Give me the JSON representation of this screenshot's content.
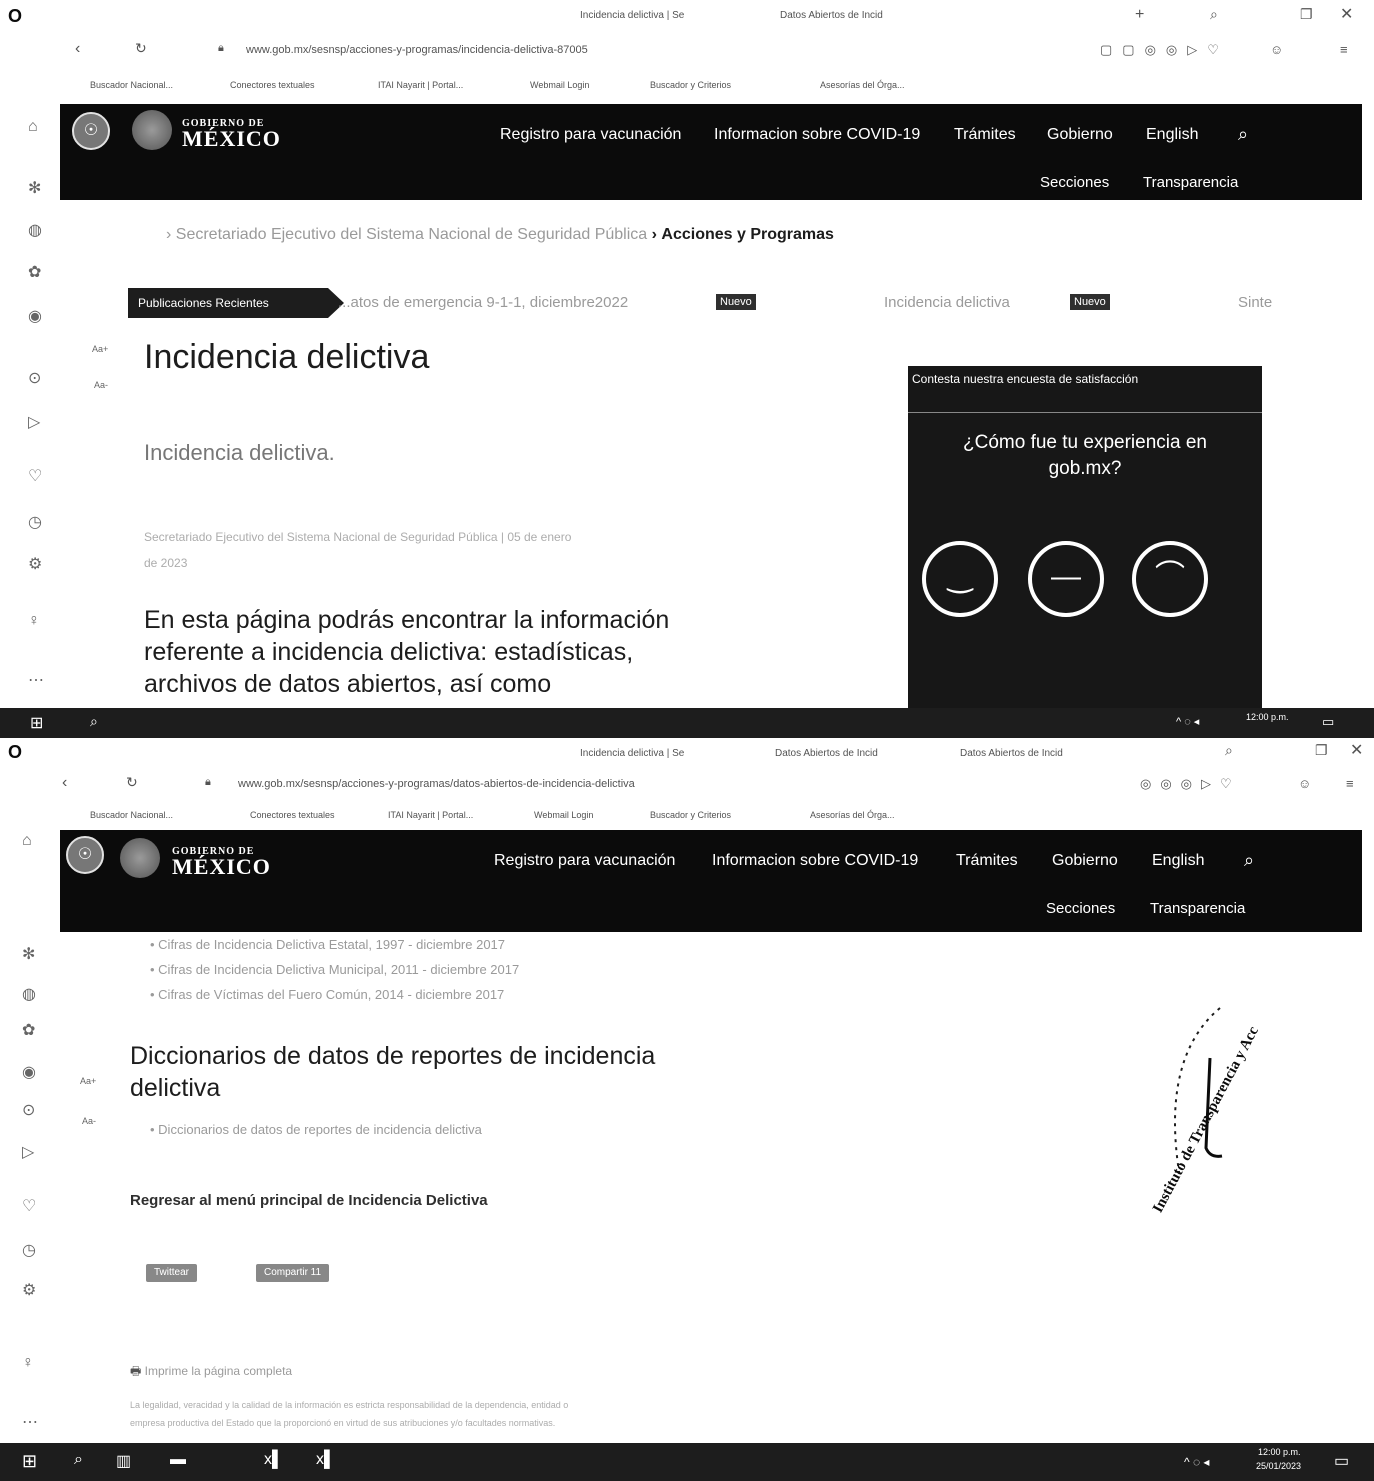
{
  "top": {
    "tabs": [
      "Incidencia delictiva | Se",
      "Datos Abiertos de Incid"
    ],
    "url": "www.gob.mx/sesnsp/acciones-y-programas/incidencia-delictiva-87005",
    "bookmarks": [
      "Buscador Nacional...",
      "Conectores textuales",
      "ITAI Nayarit | Portal...",
      "Webmail Login",
      "Buscador y Criterios",
      "Asesorías del Órga..."
    ],
    "nav": {
      "brand_small": "GOBIERNO DE",
      "brand_large": "MÉXICO",
      "links": [
        "Registro para vacunación",
        "Informacion sobre COVID-19",
        "Trámites",
        "Gobierno",
        "English"
      ],
      "sub_links": [
        "Secciones",
        "Transparencia"
      ]
    },
    "breadcrumb_prefix": "›",
    "breadcrumb_parent": "Secretariado Ejecutivo del Sistema Nacional de Seguridad Pública",
    "breadcrumb_sep": "›",
    "breadcrumb_current": "Acciones y Programas",
    "ticker": {
      "label": "Publicaciones Recientes",
      "item1": "...atos de emergencia 9-1-1, diciembre2022",
      "new_badge": "Nuevo",
      "item2": "Incidencia delictiva",
      "item3": "Sinte"
    },
    "font_tool_1": "Aa+",
    "font_tool_2": "Aa-",
    "page_title": "Incidencia delictiva",
    "subtitle": "Incidencia delictiva.",
    "meta_line1": "Secretariado Ejecutivo del Sistema Nacional de Seguridad Pública | 05 de enero",
    "meta_line2": "de 2023",
    "intro_l1": "En esta página podrás encontrar la información",
    "intro_l2": "referente a incidencia delictiva: estadísticas,",
    "intro_l3": "archivos de datos abiertos, así como",
    "survey": {
      "title": "Contesta nuestra encuesta de satisfacción",
      "question_l1": "¿Cómo fue tu experiencia en",
      "question_l2": "gob.mx?"
    },
    "clock": "12:00 p.m."
  },
  "bottom": {
    "tabs": [
      "Incidencia delictiva | Se",
      "Datos Abiertos de Incid",
      "Datos Abiertos de Incid"
    ],
    "url": "www.gob.mx/sesnsp/acciones-y-programas/datos-abiertos-de-incidencia-delictiva",
    "bookmarks": [
      "Buscador Nacional...",
      "Conectores textuales",
      "ITAI Nayarit | Portal...",
      "Webmail Login",
      "Buscador y Criterios",
      "Asesorías del Órga..."
    ],
    "nav": {
      "brand_small": "GOBIERNO DE",
      "brand_large": "MÉXICO",
      "links": [
        "Registro para vacunación",
        "Informacion sobre COVID-19",
        "Trámites",
        "Gobierno",
        "English"
      ],
      "sub_links": [
        "Secciones",
        "Transparencia"
      ]
    },
    "list1": [
      "Cifras de Incidencia Delictiva Estatal, 1997 - diciembre 2017",
      "Cifras de Incidencia Delictiva Municipal, 2011 - diciembre 2017",
      "Cifras de Víctimas del Fuero Común, 2014 - diciembre 2017"
    ],
    "font_tool_1": "Aa+",
    "font_tool_2": "Aa-",
    "section_l1": "Diccionarios de datos de reportes de incidencia",
    "section_l2": "delictiva",
    "list2": [
      "Diccionarios de datos de reportes de incidencia delictiva"
    ],
    "back_link": "Regresar al menú principal de Incidencia Delictiva",
    "share_buttons": [
      "Twittear",
      "Compartir 11"
    ],
    "print_link": "Imprime la página completa",
    "footer_l1": "La legalidad, veracidad y la calidad de la información es estricta responsabilidad de la dependencia, entidad o",
    "footer_l2": "empresa productiva del Estado que la proporcionó en virtud de sus atribuciones y/o facultades normativas.",
    "stamp_text": "Instituto de Transparencia y Acc",
    "clock_time": "12:00 p.m.",
    "clock_date": "25/01/2023"
  },
  "icons": {
    "sidebar": [
      "home-icon",
      "puzzle-icon",
      "globe-icon",
      "extensions-icon",
      "history-icon",
      "play-icon",
      "send-icon",
      "heart-icon",
      "clock-icon",
      "settings-icon",
      "bulb-icon",
      "more-icon"
    ]
  }
}
